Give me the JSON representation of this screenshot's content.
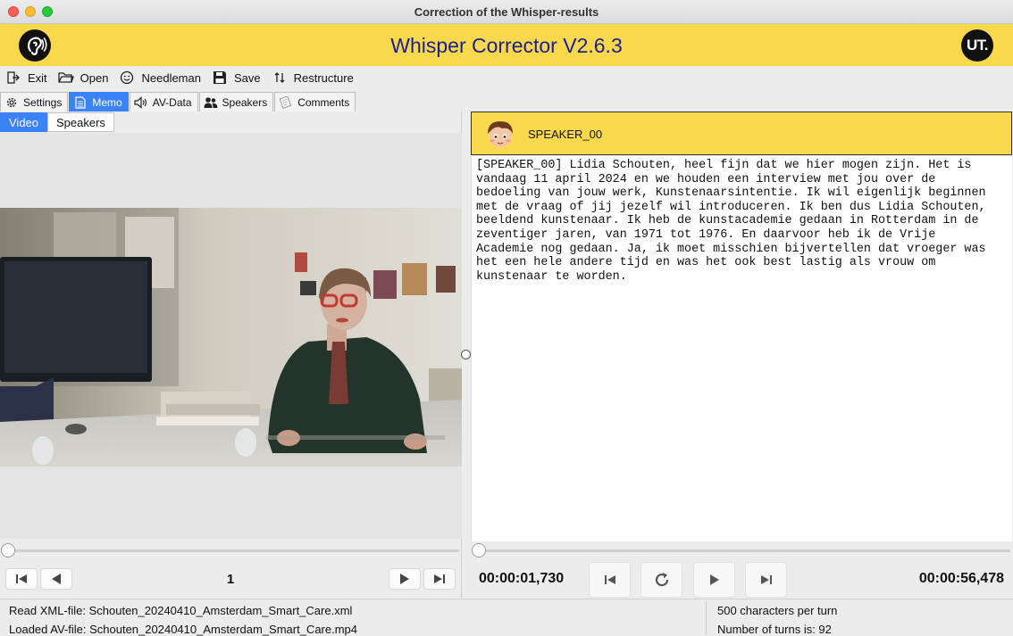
{
  "window": {
    "title": "Correction of the Whisper-results"
  },
  "header": {
    "app_title": "Whisper Corrector V2.6.3",
    "right_logo": "UT.",
    "left_logo_icon": "ear-icon"
  },
  "toolbar": {
    "items": [
      {
        "label": "Exit",
        "icon": "exit-icon"
      },
      {
        "label": "Open",
        "icon": "folder-icon"
      },
      {
        "label": "Needleman",
        "icon": "smiley-icon"
      },
      {
        "label": "Save",
        "icon": "floppy-icon"
      },
      {
        "label": "Restructure",
        "icon": "sort-arrows-icon"
      }
    ]
  },
  "tabs": [
    {
      "label": "Settings",
      "icon": "gear-icon",
      "active": false
    },
    {
      "label": "Memo",
      "icon": "document-icon",
      "active": true
    },
    {
      "label": "AV-Data",
      "icon": "speaker-icon",
      "active": false
    },
    {
      "label": "Speakers",
      "icon": "people-icon",
      "active": false
    },
    {
      "label": "Comments",
      "icon": "notes-icon",
      "active": false
    }
  ],
  "left": {
    "subtabs": [
      {
        "label": "Video",
        "active": true
      },
      {
        "label": "Speakers",
        "active": false
      }
    ],
    "page": "1",
    "video_position": 0.0
  },
  "speaker": {
    "name": "SPEAKER_00"
  },
  "transcript": "[SPEAKER_00] Lidia Schouten, heel fijn dat we hier mogen zijn. Het is\nvandaag 11 april 2024 en we houden een interview met jou over de\nbedoeling van jouw werk, Kunstenaarsintentie. Ik wil eigenlijk beginnen\nmet de vraag of jij jezelf wil introduceren. Ik ben dus Lidia Schouten,\nbeeldend kunstenaar. Ik heb de kunstacademie gedaan in Rotterdam in de\nzeventiger jaren, van 1971 tot 1976. En daarvoor heb ik de Vrije\nAcademie nog gedaan. Ja, ik moet misschien bijvertellen dat vroeger was\nhet een hele andere tijd en was het ook best lastig als vrouw om\nkunstenaar te worden.",
  "player": {
    "current_time": "00:00:01,730",
    "total_time": "00:00:56,478",
    "audio_position": 0.0
  },
  "status": {
    "xml_file": "Read XML-file: Schouten_20240410_Amsterdam_Smart_Care.xml",
    "av_file": "Loaded AV-file: Schouten_20240410_Amsterdam_Smart_Care.mp4",
    "chars_per_turn": "500 characters per turn",
    "turns": "Number of turns is: 92"
  },
  "colors": {
    "banner": "#f8d84c",
    "title": "#1c1f8c",
    "accent": "#3b82f6"
  }
}
